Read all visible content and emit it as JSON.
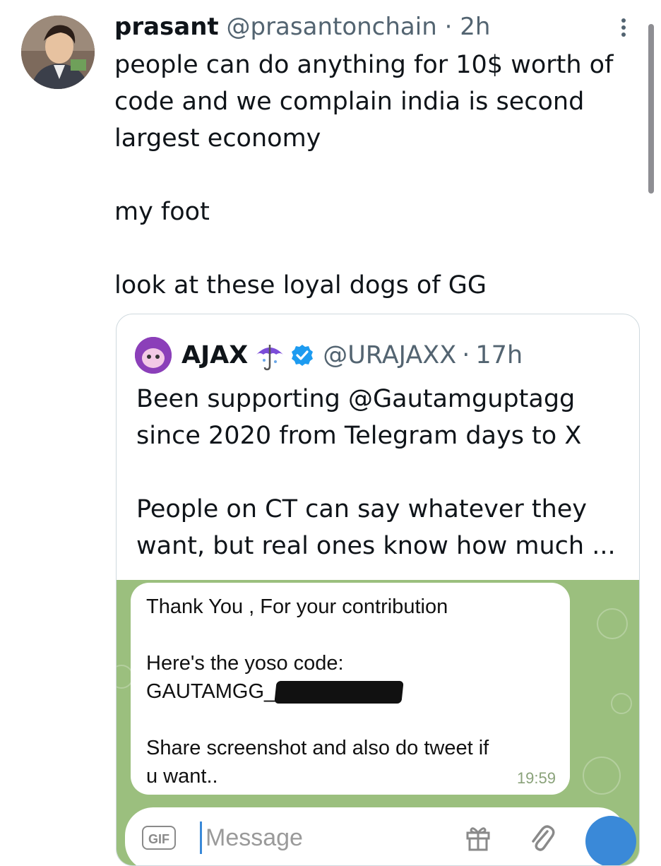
{
  "tweet": {
    "author_name": "prasant",
    "handle": "@prasantonchain",
    "separator": "·",
    "time": "2h",
    "lines": [
      "people can do anything for 10$ worth of",
      "code and we complain india is second",
      "largest economy",
      "",
      "my foot",
      "",
      "look at these loyal dogs of GG"
    ],
    "avatar_icon": "profile-photo"
  },
  "quote": {
    "author_name": "AJAX",
    "name_emoji_icon": "umbrella-icon",
    "verified_icon": "verified-badge-icon",
    "handle": "@URAJAXX",
    "separator": "·",
    "time": "17h",
    "lines": [
      "Been supporting @Gautamguptagg",
      "since 2020 from Telegram days to X",
      "",
      "People on CT can say whatever they",
      "want, but real ones know how much ..."
    ]
  },
  "telegram_screenshot": {
    "message_lines": [
      "Thank You , For your contribution",
      "",
      "Here's the yoso code:",
      "GAUTAMGG_",
      "",
      "Share screenshot and also do tweet if",
      "u want.."
    ],
    "message_time": "19:59",
    "input_placeholder": "Message",
    "gif_label": "GIF",
    "colors": {
      "chat_background": "#9bbf7e",
      "send_button": "#3a89d8"
    }
  }
}
